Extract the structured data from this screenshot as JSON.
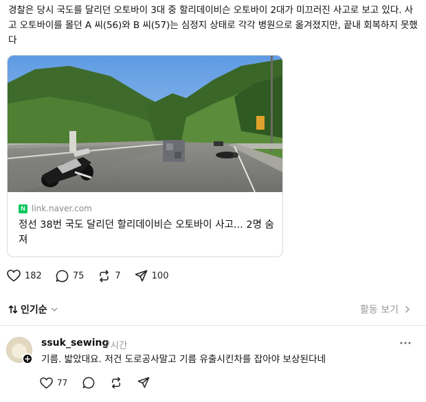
{
  "post": {
    "body": "경찰은 당시 국도를 달리던 오토바이 3대 중 할리데이비슨 오토바이 2대가 미끄러진 사고로 보고 있다. 사고 오토바이를 몰던 A 씨(56)와 B 씨(57)는 심정지 상태로 각각 병원으로 옮겨졌지만, 끝내 회복하지 못했다"
  },
  "link_card": {
    "badge": "N",
    "domain": "link.naver.com",
    "title": "정선 38번 국도 달리던 할리데이비슨 오토바이 사고... 2명 숨져"
  },
  "post_actions": {
    "likes": "182",
    "comments": "75",
    "reposts": "7",
    "shares": "100"
  },
  "replies_header": {
    "sort_label": "인기순",
    "activity_label": "활동 보기"
  },
  "reply": {
    "username": "ssuk_sewing",
    "time": "7시간",
    "text": "기름. 밟았대요. 저건 도로공사말고 기름 유출시킨차를 잡아야 보상된다네",
    "likes": "77"
  },
  "colors": {
    "naver_green": "#03c75a",
    "muted_text": "#9a9a9a"
  }
}
